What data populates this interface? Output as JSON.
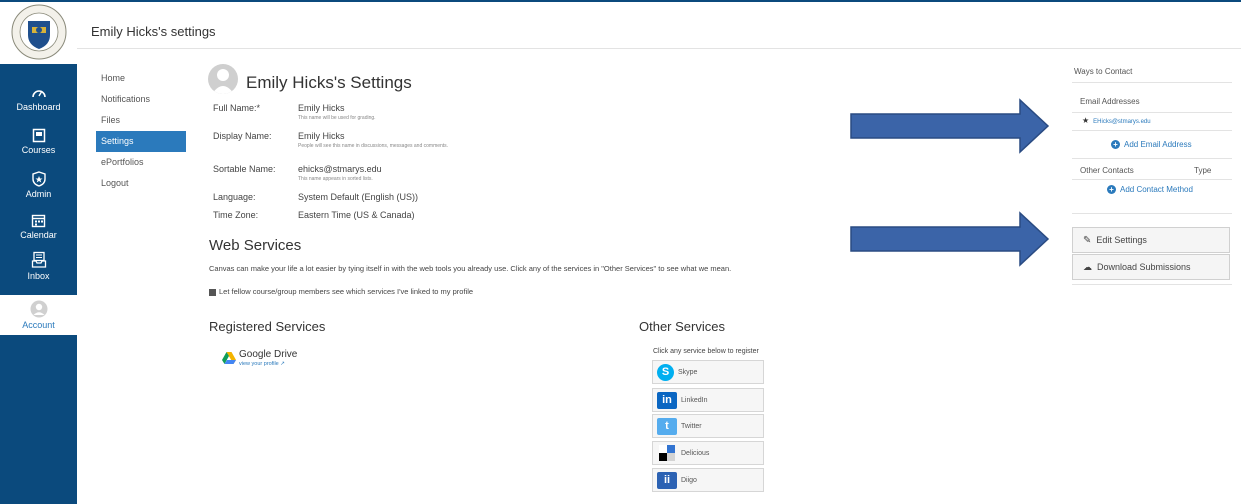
{
  "header": {
    "title": "Emily Hicks's settings"
  },
  "global_nav": [
    {
      "label": "Dashboard",
      "icon": "dashboard-icon"
    },
    {
      "label": "Courses",
      "icon": "courses-icon"
    },
    {
      "label": "Admin",
      "icon": "admin-icon"
    },
    {
      "label": "Calendar",
      "icon": "calendar-icon"
    },
    {
      "label": "Inbox",
      "icon": "inbox-icon"
    },
    {
      "label": "Account",
      "icon": "account-icon"
    }
  ],
  "subnav": [
    "Home",
    "Notifications",
    "Files",
    "Settings",
    "ePortfolios",
    "Logout"
  ],
  "profile": {
    "title": "Emily Hicks's Settings",
    "full_name_label": "Full Name:*",
    "full_name": "Emily Hicks",
    "full_name_hint": "This name will be used for grading.",
    "display_name_label": "Display Name:",
    "display_name": "Emily Hicks",
    "display_name_hint": "People will see this name in discussions, messages and comments.",
    "sortable_name_label": "Sortable Name:",
    "sortable_name": "ehicks@stmarys.edu",
    "sortable_name_hint": "This name appears in sorted lists.",
    "language_label": "Language:",
    "language": "System Default (English (US))",
    "timezone_label": "Time Zone:",
    "timezone": "Eastern Time (US & Canada)"
  },
  "web_services": {
    "title": "Web Services",
    "description": "Canvas can make your life a lot easier by tying itself in with the web tools you already use. Click any of the services in \"Other Services\" to see what we mean.",
    "checkbox_label": "Let fellow course/group members see which services I've linked to my profile"
  },
  "registered": {
    "title": "Registered Services",
    "service_name": "Google Drive",
    "service_link": "view your profile"
  },
  "other": {
    "title": "Other Services",
    "hint": "Click any service below to register",
    "services": [
      "Skype",
      "LinkedIn",
      "Twitter",
      "Delicious",
      "Diigo"
    ]
  },
  "sidebar": {
    "ways_title": "Ways to Contact",
    "email_heading": "Email Addresses",
    "email": "EHicks@stmarys.edu",
    "add_email": "Add Email Address",
    "other_contacts": "Other Contacts",
    "type_label": "Type",
    "add_contact": "Add Contact Method",
    "edit_settings": "Edit Settings",
    "download": "Download Submissions"
  },
  "colors": {
    "nav": "#0b4a7d",
    "accent": "#2b7abc",
    "arrow": "#3b64a8"
  }
}
